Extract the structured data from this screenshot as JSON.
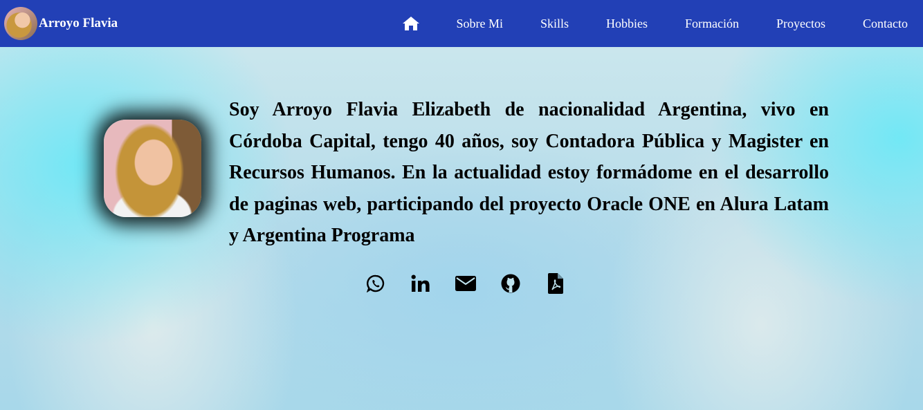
{
  "header": {
    "brand_name": "Arroyo Flavia",
    "nav": {
      "home_icon": "home-icon",
      "items": [
        {
          "label": "Sobre Mi"
        },
        {
          "label": "Skills"
        },
        {
          "label": "Hobbies"
        },
        {
          "label": "Formación"
        },
        {
          "label": "Proyectos"
        },
        {
          "label": "Contacto"
        }
      ]
    }
  },
  "main": {
    "bio": "Soy Arroyo Flavia Elizabeth de nacionalidad Argentina, vivo en Córdoba Capital, tengo 40 años, soy Contadora Pública y Magister en Recursos Humanos. En la actualidad estoy formádome en el desarrollo de paginas web, participando del proyecto Oracle ONE en Alura Latam y Argentina Programa",
    "social_icons": [
      "whatsapp-icon",
      "linkedin-icon",
      "email-icon",
      "github-icon",
      "pdf-file-icon"
    ]
  },
  "colors": {
    "header_bg": "#2240b6",
    "header_text": "#ffffff",
    "body_text": "#000000",
    "bg_accent": "#6ee8f6"
  }
}
